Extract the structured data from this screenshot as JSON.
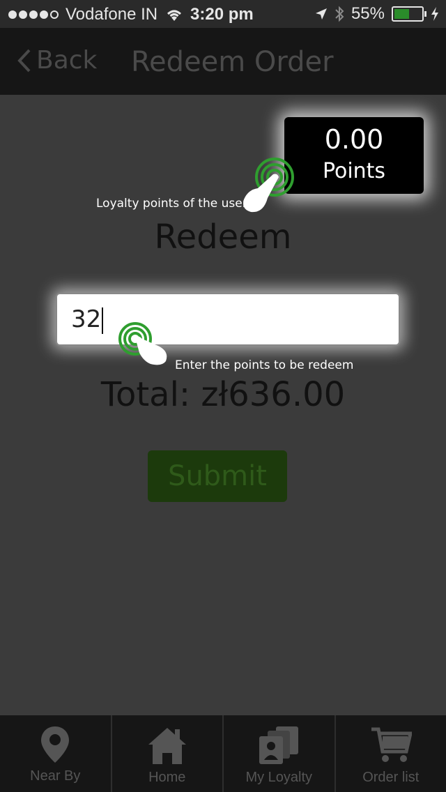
{
  "status_bar": {
    "carrier": "Vodafone IN",
    "time": "3:20 pm",
    "battery": "55%",
    "battery_level": 0.55
  },
  "nav": {
    "back_label": "Back",
    "title": "Redeem Order"
  },
  "points": {
    "value": "0.00",
    "label": "Points"
  },
  "hints": {
    "loyalty": "Loyalty points of the user",
    "redeem_entry": "Enter the points to be redeem"
  },
  "redeem": {
    "title": "Redeem",
    "input_value": "32",
    "total": "Total: zł636.00",
    "submit_label": "Submit"
  },
  "tabs": [
    {
      "label": "Near By",
      "icon": "location-pin-icon"
    },
    {
      "label": "Home",
      "icon": "home-icon"
    },
    {
      "label": "My Loyalty",
      "icon": "loyalty-cards-icon"
    },
    {
      "label": "Order list",
      "icon": "shopping-cart-icon"
    }
  ]
}
